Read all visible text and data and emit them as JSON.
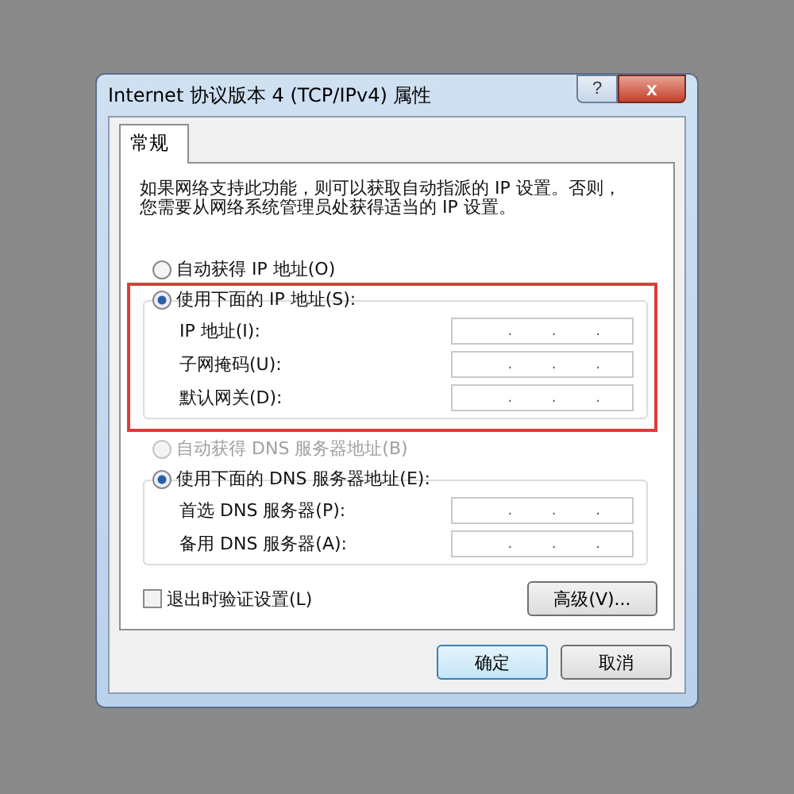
{
  "window": {
    "title": "Internet 协议版本 4 (TCP/IPv4) 属性",
    "help_button": "?",
    "close_button": "x"
  },
  "tabs": [
    {
      "label": "常规",
      "selected": true
    }
  ],
  "description": "如果网络支持此功能，则可以获取自动指派的 IP 设置。否则，您需要从网络系统管理员处获得适当的 IP 设置。",
  "ip_section": {
    "highlighted": true,
    "auto_option": {
      "label": "自动获得 IP 地址(O)",
      "selected": false,
      "disabled": false
    },
    "manual_option": {
      "label": "使用下面的 IP 地址(S):",
      "selected": true,
      "disabled": false
    },
    "fields": [
      {
        "label": "IP 地址(I):",
        "value": ". . ."
      },
      {
        "label": "子网掩码(U):",
        "value": ". . ."
      },
      {
        "label": "默认网关(D):",
        "value": ". . ."
      }
    ]
  },
  "dns_section": {
    "auto_option": {
      "label": "自动获得 DNS 服务器地址(B)",
      "selected": false,
      "disabled": true
    },
    "manual_option": {
      "label": "使用下面的 DNS 服务器地址(E):",
      "selected": true,
      "disabled": false
    },
    "fields": [
      {
        "label": "首选 DNS 服务器(P):",
        "value": ". . ."
      },
      {
        "label": "备用 DNS 服务器(A):",
        "value": ". . ."
      }
    ]
  },
  "validate_checkbox": {
    "label": "退出时验证设置(L)",
    "checked": false
  },
  "advanced_button": "高级(V)...",
  "buttons": [
    {
      "label": "确定",
      "selected": true
    },
    {
      "label": "取消",
      "selected": false
    }
  ]
}
